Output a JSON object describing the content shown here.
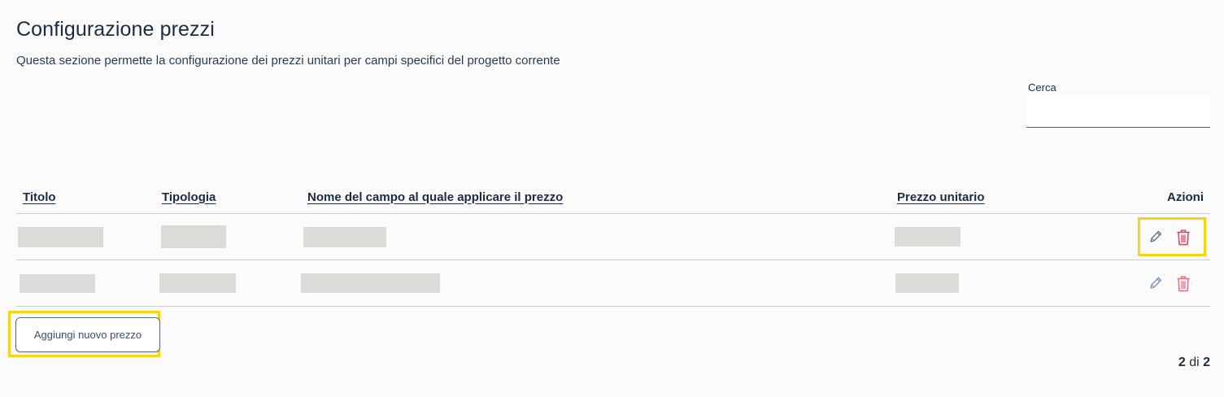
{
  "header": {
    "title": "Configurazione prezzi",
    "description": "Questa sezione permette la configurazione dei prezzi unitari per campi specifici del progetto corrente"
  },
  "search": {
    "label": "Cerca",
    "value": "",
    "placeholder": ""
  },
  "table": {
    "columns": {
      "title": "Titolo",
      "type": "Tipologia",
      "field_name": "Nome del campo al quale applicare il prezzo",
      "unit_price": "Prezzo unitario",
      "actions": "Azioni"
    },
    "rows": [
      {
        "redacted": true,
        "highlighted_actions": true
      },
      {
        "redacted": true,
        "highlighted_actions": false
      }
    ]
  },
  "icons": {
    "edit": "pencil-icon",
    "delete": "trash-icon"
  },
  "colors": {
    "edit_icon": "#5b6fa0",
    "delete_icon": "#e0415a",
    "highlight": "#f8d417",
    "redaction": "#dddbd7"
  },
  "buttons": {
    "add_price": "Aggiungi nuovo prezzo"
  },
  "pagination": {
    "current": "2",
    "separator": "di",
    "total": "2"
  }
}
